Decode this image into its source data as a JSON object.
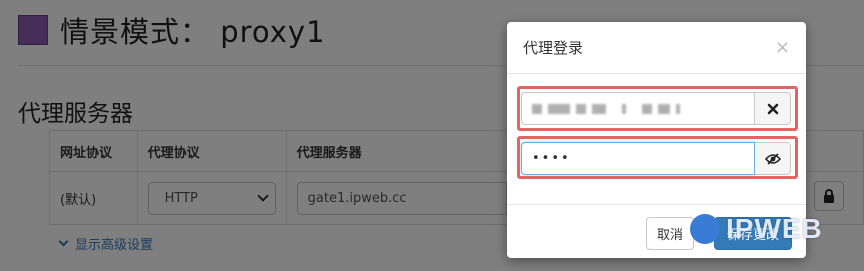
{
  "profile": {
    "title": "情景模式： proxy1",
    "color": "#8e5cb0"
  },
  "section": {
    "title": "代理服务器"
  },
  "table": {
    "headers": [
      "网址协议",
      "代理协议",
      "代理服务器"
    ],
    "row": {
      "scheme": "(默认)",
      "protocol": "HTTP",
      "server": "gate1.ipweb.cc"
    }
  },
  "advanced_link": "显示高级设置",
  "modal": {
    "title": "代理登录",
    "close": "×",
    "password_value": "••••",
    "cancel_label": "取消",
    "save_label": "保存更改"
  },
  "watermark": {
    "text": "IPWEB"
  }
}
